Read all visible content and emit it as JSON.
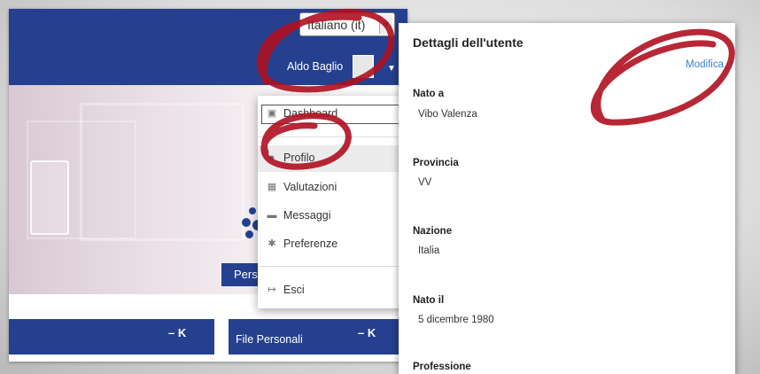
{
  "header": {
    "language": "Italiano (it)",
    "user_name": "Aldo Baglio"
  },
  "hero": {
    "button_label": "Pers"
  },
  "blocks": [
    {
      "label": "",
      "controls": "– K"
    },
    {
      "label": "File Personali",
      "controls": "– K"
    }
  ],
  "user_menu": {
    "items": [
      {
        "label": "Dashboard",
        "icon": "dashboard-icon"
      },
      {
        "label": "Profilo",
        "icon": "user-icon",
        "active": true
      },
      {
        "label": "Valutazioni",
        "icon": "grades-icon"
      },
      {
        "label": "Messaggi",
        "icon": "message-icon"
      },
      {
        "label": "Preferenze",
        "icon": "gear-icon"
      },
      {
        "label": "Esci",
        "icon": "logout-icon"
      }
    ]
  },
  "profile": {
    "title": "Dettagli dell'utente",
    "edit_link": "Modifica",
    "fields": [
      {
        "label": "Nato a",
        "value": "Vibo Valenza"
      },
      {
        "label": "Provincia",
        "value": "VV"
      },
      {
        "label": "Nazione",
        "value": "Italia"
      },
      {
        "label": "Nato il",
        "value": "5 dicembre 1980"
      },
      {
        "label": "Professione",
        "value": ""
      }
    ]
  },
  "colors": {
    "brand_blue": "#25408f",
    "annotation_red": "#b01020",
    "link_blue": "#3a7fd0"
  }
}
